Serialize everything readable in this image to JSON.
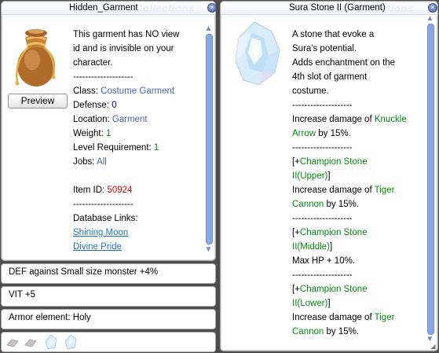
{
  "left": {
    "title": "Hidden_Garment",
    "watermark": "Collections",
    "close": "×",
    "preview_label": "Preview",
    "desc1": "This garment has NO view",
    "desc2": "id and is invisible on your",
    "desc3": "character.",
    "divider": "--------------------",
    "class_label": "Class: ",
    "class_value": "Costume Garment",
    "defense_label": "Defense: ",
    "defense_value": "0",
    "location_label": "Location: ",
    "location_value": "Garment",
    "weight_label": "Weight: ",
    "weight_value": "1",
    "level_label": "Level Requirement: ",
    "level_value": "1",
    "jobs_label": "Jobs: ",
    "jobs_value": "All",
    "itemid_label": "Item ID: ",
    "itemid_value": "50924",
    "divider2": "--------------------",
    "db_links": "Database Links:",
    "link1": "Shining Moon",
    "link2": "Divine Pride"
  },
  "bars": [
    "DEF against Small size monster +4%",
    "VIT +5",
    "Armor element: Holy"
  ],
  "right": {
    "title": "Sura Stone II (Garment)",
    "watermark": "Collections",
    "close": "×",
    "d1": "A stone that evoke a",
    "d2": "Sura's potential.",
    "d3": "Adds enchantment on the",
    "d4": "4th slot of garment",
    "d5": "costume.",
    "sep": "--------------------",
    "e1a": "Increase damage of ",
    "e1b": "Knuckle",
    "e2a": "Arrow",
    "e2b": " by 15%.",
    "b1": "[+",
    "s1a": "Champion Stone",
    "s1b": "II(Upper)",
    "close_br": "]",
    "e3a": "Increase damage of ",
    "e3b": "Tiger",
    "e4a": "Cannon",
    "e4b": " by 15%.",
    "s2a": "Champion Stone",
    "s2b": "II(Middle)",
    "hp": "Max HP + 10%.",
    "s3a": "Champion Stone",
    "s3b": "II(Lower)"
  },
  "colors": {
    "blue": "#4b5fb0",
    "green": "#00880e",
    "red": "#d00000",
    "link": "#1d72c9",
    "scroll": "#8aa8e2"
  }
}
